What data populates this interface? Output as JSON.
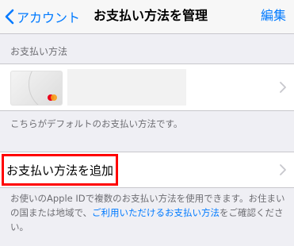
{
  "nav": {
    "back_label": "アカウント",
    "title": "お支払い方法を管理",
    "edit_label": "編集",
    "accent_color": "#007aff"
  },
  "payment_section": {
    "header": "お支払い方法",
    "card_brand_icon": "mastercard-logo",
    "default_note": "こちらがデフォルトのお支払い方法です。"
  },
  "add_row": {
    "label": "お支払い方法を追加",
    "highlight_color": "#ff0000"
  },
  "info_note": {
    "text_before_link": "お使いのApple IDで複数のお支払い方法を使用できます。お住まいの国または地域で、",
    "link_text": "ご利用いただけるお支払い方法",
    "text_after_link": "をご確認ください。"
  }
}
